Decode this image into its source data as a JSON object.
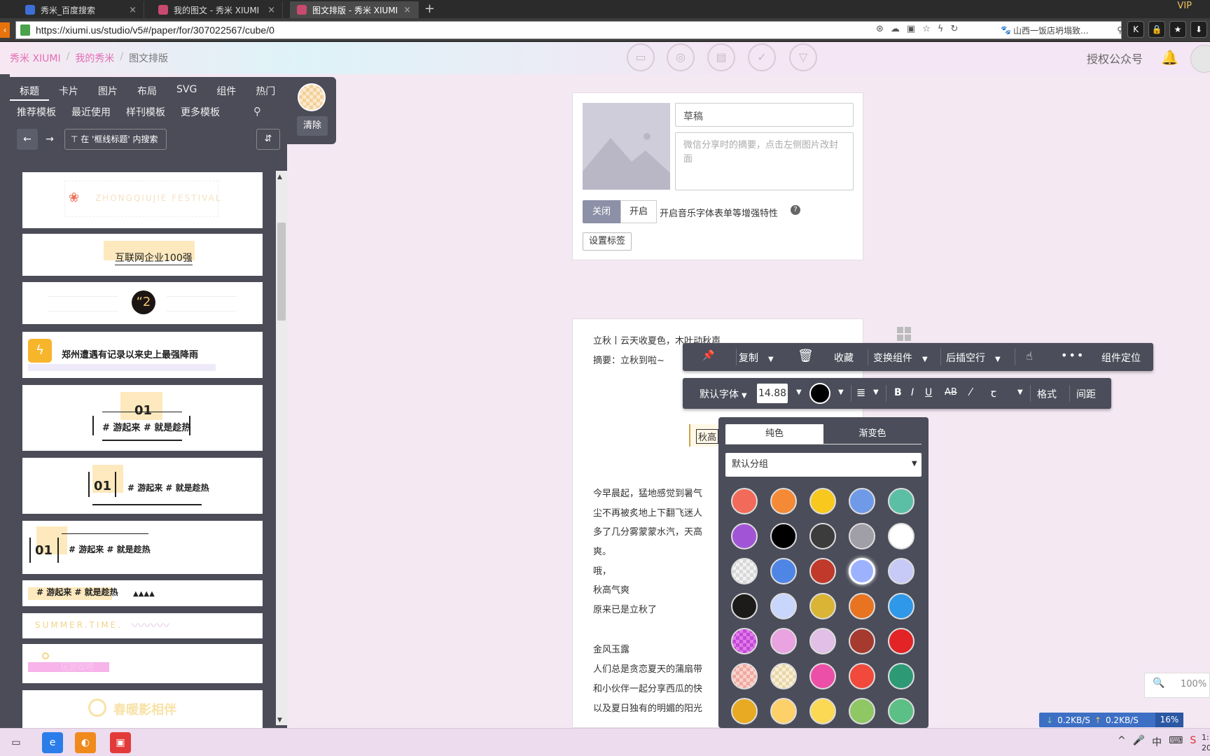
{
  "browser": {
    "tabs": [
      {
        "title": "秀米_百度搜索",
        "close": "×"
      },
      {
        "title": "我的图文 - 秀米 XIUMI",
        "close": "×"
      },
      {
        "title": "图文排版 - 秀米 XIUMI",
        "close": "×"
      }
    ],
    "new_tab": "+",
    "vip": "VIP",
    "url": "https://xiumi.us/studio/v5#/paper/for/307022567/cube/0",
    "search_text": "山西一饭店坍塌致..."
  },
  "header": {
    "breadcrumb": [
      "秀米 XIUMI",
      "我的秀米",
      "图文排版"
    ],
    "auth": "授权公众号"
  },
  "left_panel": {
    "tabs": [
      "标题",
      "卡片",
      "图片",
      "布局",
      "SVG",
      "组件",
      "热门"
    ],
    "subtabs": [
      "推荐模板",
      "最近使用",
      "样刊模板",
      "更多模板"
    ],
    "filter_label": "在 '框线标题' 内搜索",
    "clear_label": "清除",
    "templates": {
      "t0": "ZHONGQIUJIE FESTIVAL",
      "t1": "互联网企业100强",
      "t2": "“2",
      "t3": "郑州遭遇有记录以来史上最强降雨",
      "t4_num": "01",
      "t4_text": "# 游起来 # 就是趁热",
      "t5_num": "01",
      "t5_text": "# 游起来 # 就是趁热",
      "t6_num": "01",
      "t6_text": "# 游起来 # 就是趁热",
      "t7_text": "# 游起来 # 就是趁热",
      "t8_text": "SUMMER.TIME.",
      "t9_text": "玩游戏吧",
      "t10_text": "春暖影相伴"
    }
  },
  "editor": {
    "title_value": "草稿",
    "summary_placeholder": "微信分享时的摘要，点击左侧图片改封面",
    "toggle_off": "关闭",
    "toggle_on": "开启",
    "enhance_label": "开启音乐字体表单等增强特性",
    "help": "?",
    "tag_button": "设置标签",
    "article": {
      "line1": "立秋丨云天收夏色，木叶动秋声",
      "line2": "摘要：立秋到啦~",
      "tag_text": "秋高",
      "p1": "今早晨起，猛地感觉到暑气",
      "p2": "尘不再被炙地上下翻飞迷人",
      "p3": "多了几分雾蒙蒙水汽，天高",
      "p4": "爽。",
      "p5": "哦，",
      "p6": "秋高气爽",
      "p7": "原来已是立秋了",
      "p8": "金风玉露",
      "p9": "人们总是贪恋夏天的蒲扇带",
      "p10": "和小伙伴一起分享西瓜的快",
      "p11": "以及夏日独有的明媚的阳光"
    }
  },
  "toolbar1": {
    "copy": "复制",
    "favorite": "收藏",
    "transform": "变换组件",
    "insert_after": "后插空行",
    "more": "•••",
    "locate": "组件定位"
  },
  "toolbar2": {
    "font": "默认字体",
    "font_size": "14.88",
    "format": "格式",
    "spacing": "间距",
    "bold": "B",
    "italic": "I",
    "underline": "U",
    "strike": "AB"
  },
  "color_picker": {
    "tab_solid": "纯色",
    "tab_gradient": "渐变色",
    "group": "默认分组",
    "swatches": [
      [
        "#f26a5a",
        "#f58a36",
        "#f8c81e",
        "#6f9ae8",
        "#5abfa5"
      ],
      [
        "#a155d6",
        "#000000",
        "#3c3c3c",
        "#a09ea6",
        "#ffffff"
      ],
      [
        "checker",
        "#4f86e6",
        "#c0392b",
        "#9db2ff",
        "#c7caf6"
      ],
      [
        "#1d1a1a",
        "#c9d6fb",
        "#d9b435",
        "#e87422",
        "#2f98e8"
      ],
      [
        "checker-magenta",
        "#e8a3e0",
        "#e2bfe6",
        "#a63a2e",
        "#e22426"
      ],
      [
        "checker-pink",
        "checker-cream",
        "#ec4fa8",
        "#f14a3c",
        "#2e9a75"
      ],
      [
        "#e8aa22",
        "#fdd06a",
        "#fbd955",
        "#8fc765",
        "#5cbf86"
      ]
    ],
    "selected": "#9db2ff"
  },
  "status": {
    "zoom": "100%",
    "down": "0.2KB/S",
    "up": "0.2KB/S",
    "percent": "16%",
    "clock_time": "1:",
    "clock_date": "202"
  }
}
